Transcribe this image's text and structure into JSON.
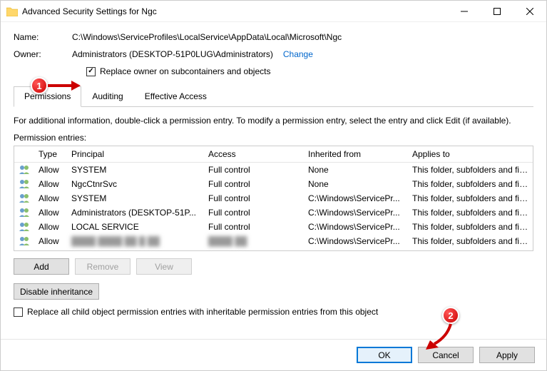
{
  "window": {
    "title": "Advanced Security Settings for Ngc"
  },
  "fields": {
    "name_label": "Name:",
    "name_value": "C:\\Windows\\ServiceProfiles\\LocalService\\AppData\\Local\\Microsoft\\Ngc",
    "owner_label": "Owner:",
    "owner_value": "Administrators (DESKTOP-51P0LUG\\Administrators)",
    "change_link": "Change",
    "replace_owner": "Replace owner on subcontainers and objects"
  },
  "tabs": {
    "permissions": "Permissions",
    "auditing": "Auditing",
    "effective": "Effective Access"
  },
  "info_text": "For additional information, double-click a permission entry. To modify a permission entry, select the entry and click Edit (if available).",
  "entries_label": "Permission entries:",
  "columns": {
    "type": "Type",
    "principal": "Principal",
    "access": "Access",
    "inherited": "Inherited from",
    "applies": "Applies to"
  },
  "rows": [
    {
      "type": "Allow",
      "principal": "SYSTEM",
      "access": "Full control",
      "inherited": "None",
      "applies": "This folder, subfolders and files"
    },
    {
      "type": "Allow",
      "principal": "NgcCtnrSvc",
      "access": "Full control",
      "inherited": "None",
      "applies": "This folder, subfolders and files"
    },
    {
      "type": "Allow",
      "principal": "SYSTEM",
      "access": "Full control",
      "inherited": "C:\\Windows\\ServicePr...",
      "applies": "This folder, subfolders and files"
    },
    {
      "type": "Allow",
      "principal": "Administrators (DESKTOP-51P...",
      "access": "Full control",
      "inherited": "C:\\Windows\\ServicePr...",
      "applies": "This folder, subfolders and files"
    },
    {
      "type": "Allow",
      "principal": "LOCAL SERVICE",
      "access": "Full control",
      "inherited": "C:\\Windows\\ServicePr...",
      "applies": "This folder, subfolders and files"
    },
    {
      "type": "Allow",
      "principal": "████ ████ ██ █ ██",
      "access": "████ ██",
      "inherited": "C:\\Windows\\ServicePr...",
      "applies": "This folder, subfolders and files"
    }
  ],
  "buttons": {
    "add": "Add",
    "remove": "Remove",
    "view": "View",
    "disable_inherit": "Disable inheritance",
    "replace_children": "Replace all child object permission entries with inheritable permission entries from this object",
    "ok": "OK",
    "cancel": "Cancel",
    "apply": "Apply"
  },
  "annotations": {
    "one": "1",
    "two": "2"
  }
}
